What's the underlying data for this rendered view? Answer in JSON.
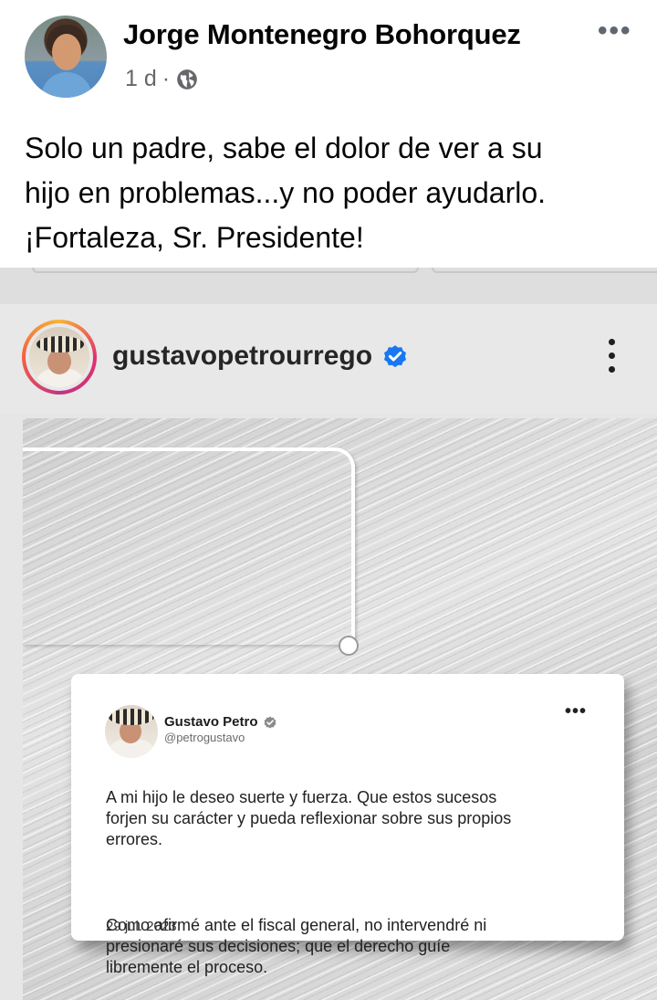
{
  "post": {
    "author_name": "Jorge Montenegro Bohorquez",
    "time": "1 d",
    "separator": "·",
    "privacy_icon": "globe-icon",
    "more_label": "•••",
    "text_lines": [
      "Solo un padre, sabe el dolor de ver a su",
      "hijo en problemas...y no poder  ayudarlo.",
      "¡Fortaleza, Sr. Presidente!"
    ]
  },
  "instagram": {
    "username": "gustavopetrourrego",
    "verified_icon": "verified-badge-icon",
    "more_icon": "vertical-ellipsis-icon"
  },
  "tweet": {
    "name": "Gustavo Petro",
    "handle": "@petrogustavo",
    "more_label": "•••",
    "paragraph1_lines": [
      "A mi hijo le deseo suerte y fuerza. Que estos sucesos",
      "forjen su carácter y pueda reflexionar sobre sus propios",
      "errores."
    ],
    "paragraph2_lines": [
      "Como afirmé ante el fiscal general, no intervendré ni",
      "presionaré sus decisiones; que el derecho guíe",
      "libremente el proceso."
    ],
    "date": "29 jul. 2023"
  },
  "colors": {
    "verified_blue": "#1877f2",
    "meta_gray": "#65676b"
  }
}
